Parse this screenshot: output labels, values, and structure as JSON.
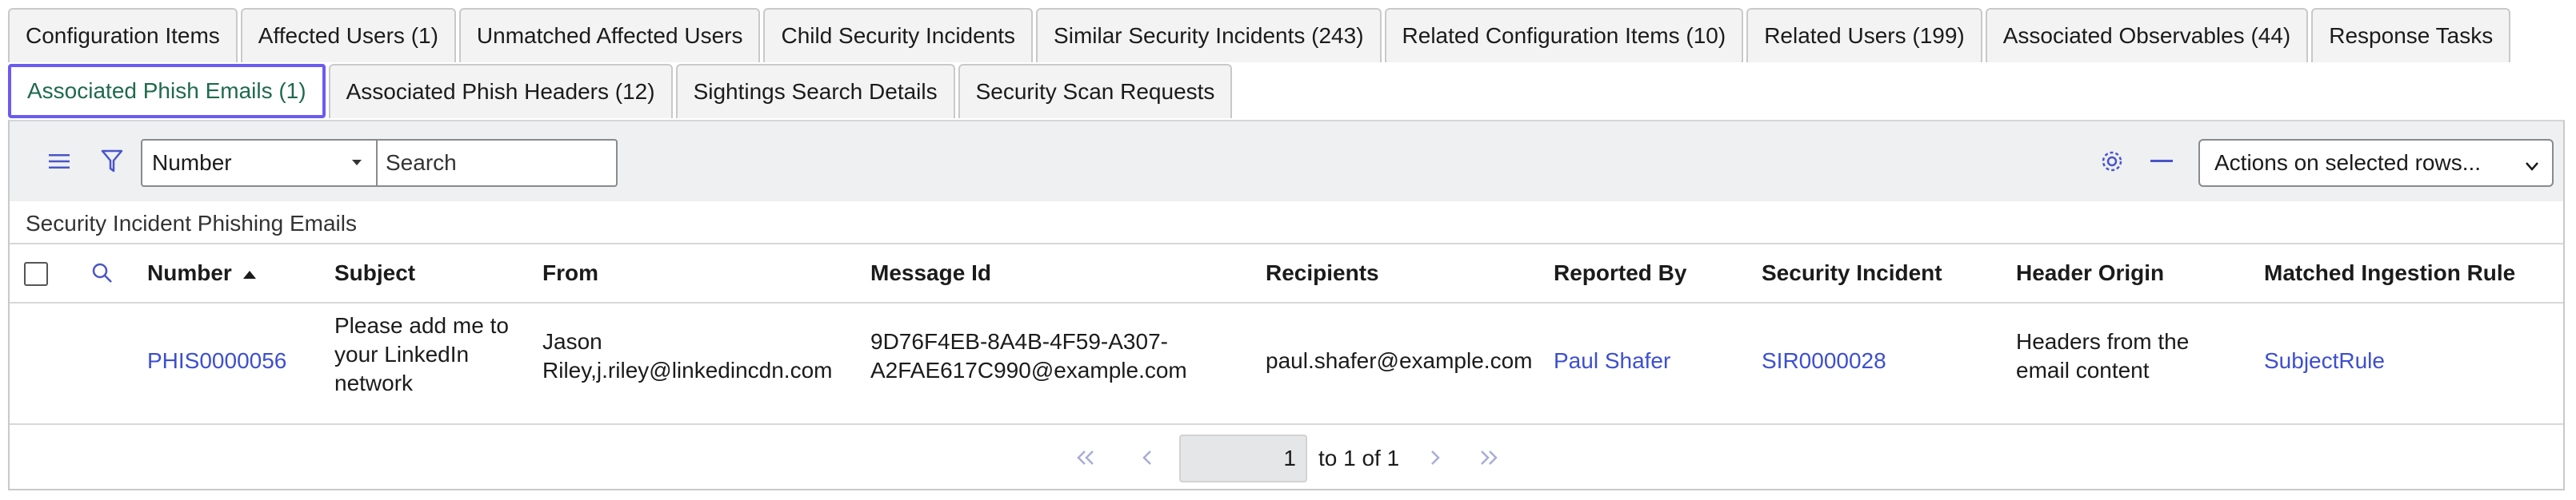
{
  "tabs_row1": [
    "Configuration Items",
    "Affected Users (1)",
    "Unmatched Affected Users",
    "Child Security Incidents",
    "Similar Security Incidents (243)",
    "Related Configuration Items (10)",
    "Related Users (199)",
    "Associated Observables (44)",
    "Response Tasks"
  ],
  "tabs_row2": [
    "Associated Phish Emails (1)",
    "Associated Phish Headers (12)",
    "Sightings Search Details",
    "Security Scan Requests"
  ],
  "active_tab": "Associated Phish Emails (1)",
  "toolbar": {
    "field_select": "Number",
    "search_placeholder": "Search",
    "actions_select": "Actions on selected rows..."
  },
  "list": {
    "title": "Security Incident Phishing Emails",
    "columns": [
      "Number",
      "Subject",
      "From",
      "Message Id",
      "Recipients",
      "Reported By",
      "Security Incident",
      "Header Origin",
      "Matched Ingestion Rule"
    ],
    "rows": [
      {
        "number": "PHIS0000056",
        "subject_l1": "Please add me to",
        "subject_l2": "your LinkedIn",
        "subject_l3": "network",
        "from_l1": "Jason",
        "from_l2": "Riley,j.riley@linkedincdn.com",
        "message_id_l1": "9D76F4EB-8A4B-4F59-A307-",
        "message_id_l2": "A2FAE617C990@example.com",
        "recipients": "paul.shafer@example.com",
        "reported_by": "Paul Shafer",
        "security_incident": "SIR0000028",
        "header_origin_l1": "Headers from the",
        "header_origin_l2": "email content",
        "matched_rule": "SubjectRule"
      }
    ]
  },
  "pagination": {
    "current_page": "1",
    "range_text": "to 1 of 1"
  },
  "colors": {
    "accent_border": "#6b5bf0",
    "active_tab_text": "#1f6a4d",
    "link": "#3d4fd0",
    "toolbar_bg": "#eef0f2"
  }
}
